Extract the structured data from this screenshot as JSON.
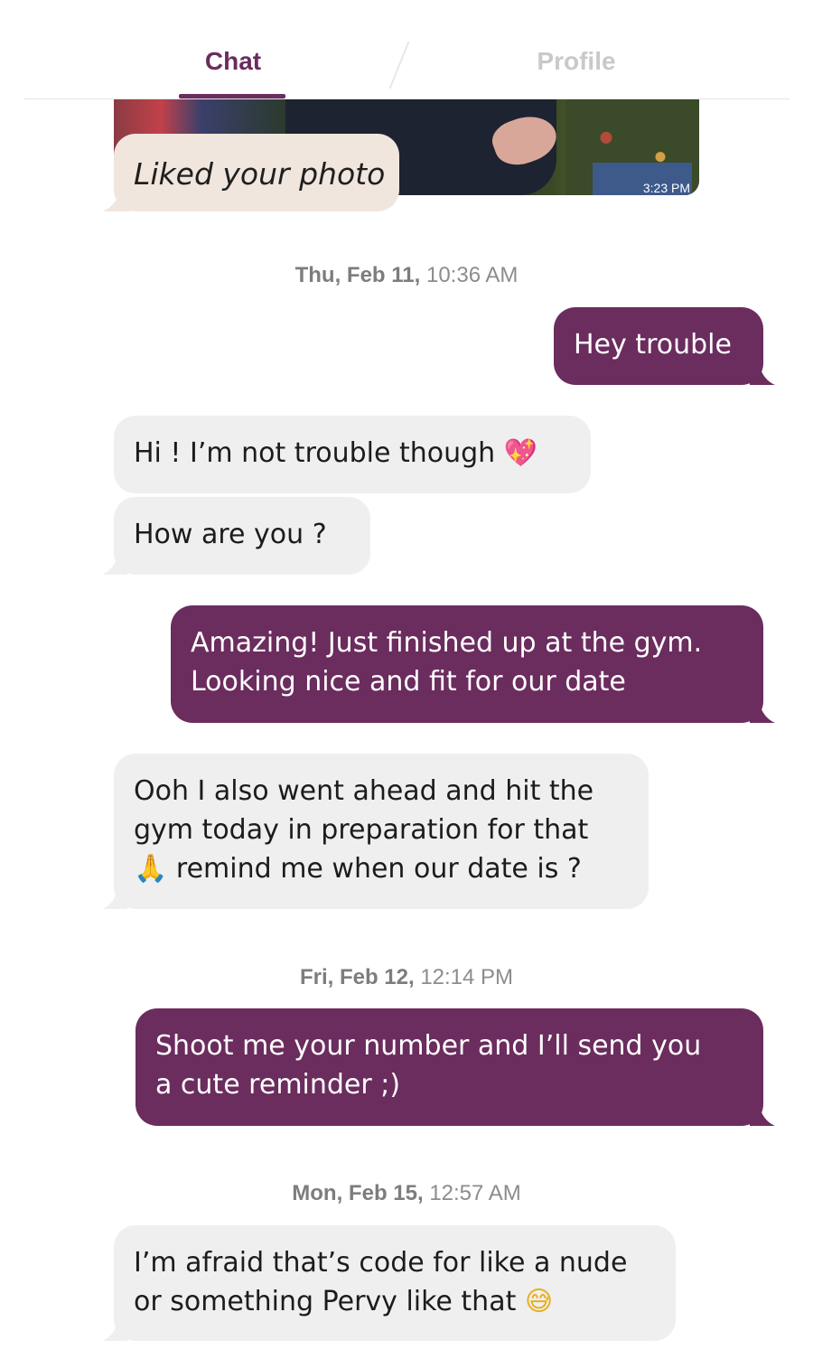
{
  "tabs": {
    "chat": "Chat",
    "profile": "Profile"
  },
  "photo": {
    "time": "3:23 PM"
  },
  "liked": {
    "text": "Liked your photo"
  },
  "stamps": [
    {
      "day": "Thu, Feb 11,",
      "time": "10:36 AM"
    },
    {
      "day": "Fri, Feb 12,",
      "time": "12:14 PM"
    },
    {
      "day": "Mon, Feb 15,",
      "time": "12:57 AM"
    }
  ],
  "messages": {
    "m1": {
      "text": "Hey trouble"
    },
    "m2": {
      "text": "Hi ! I’m not trouble though",
      "emoji": "💖"
    },
    "m3": {
      "text": "How are you ?"
    },
    "m4": {
      "line1": "Amazing! Just finished up at the gym.",
      "line2": "Looking nice and fit for our date"
    },
    "m5": {
      "line1": "Ooh I also went ahead and hit the",
      "line2": "gym today in preparation for that",
      "emoji": "🙏",
      "line3": "remind me when our date is ?"
    },
    "m6": {
      "line1": "Shoot me your number and I’ll send you",
      "line2": "a cute reminder ;)"
    },
    "m7": {
      "line1": "I’m afraid that’s code for like a nude",
      "line2": "or something Pervy like that",
      "emoji": "😅"
    }
  },
  "colors": {
    "accent": "#6b2c5e",
    "incoming": "#efefef",
    "liked": "#f1e6de"
  }
}
